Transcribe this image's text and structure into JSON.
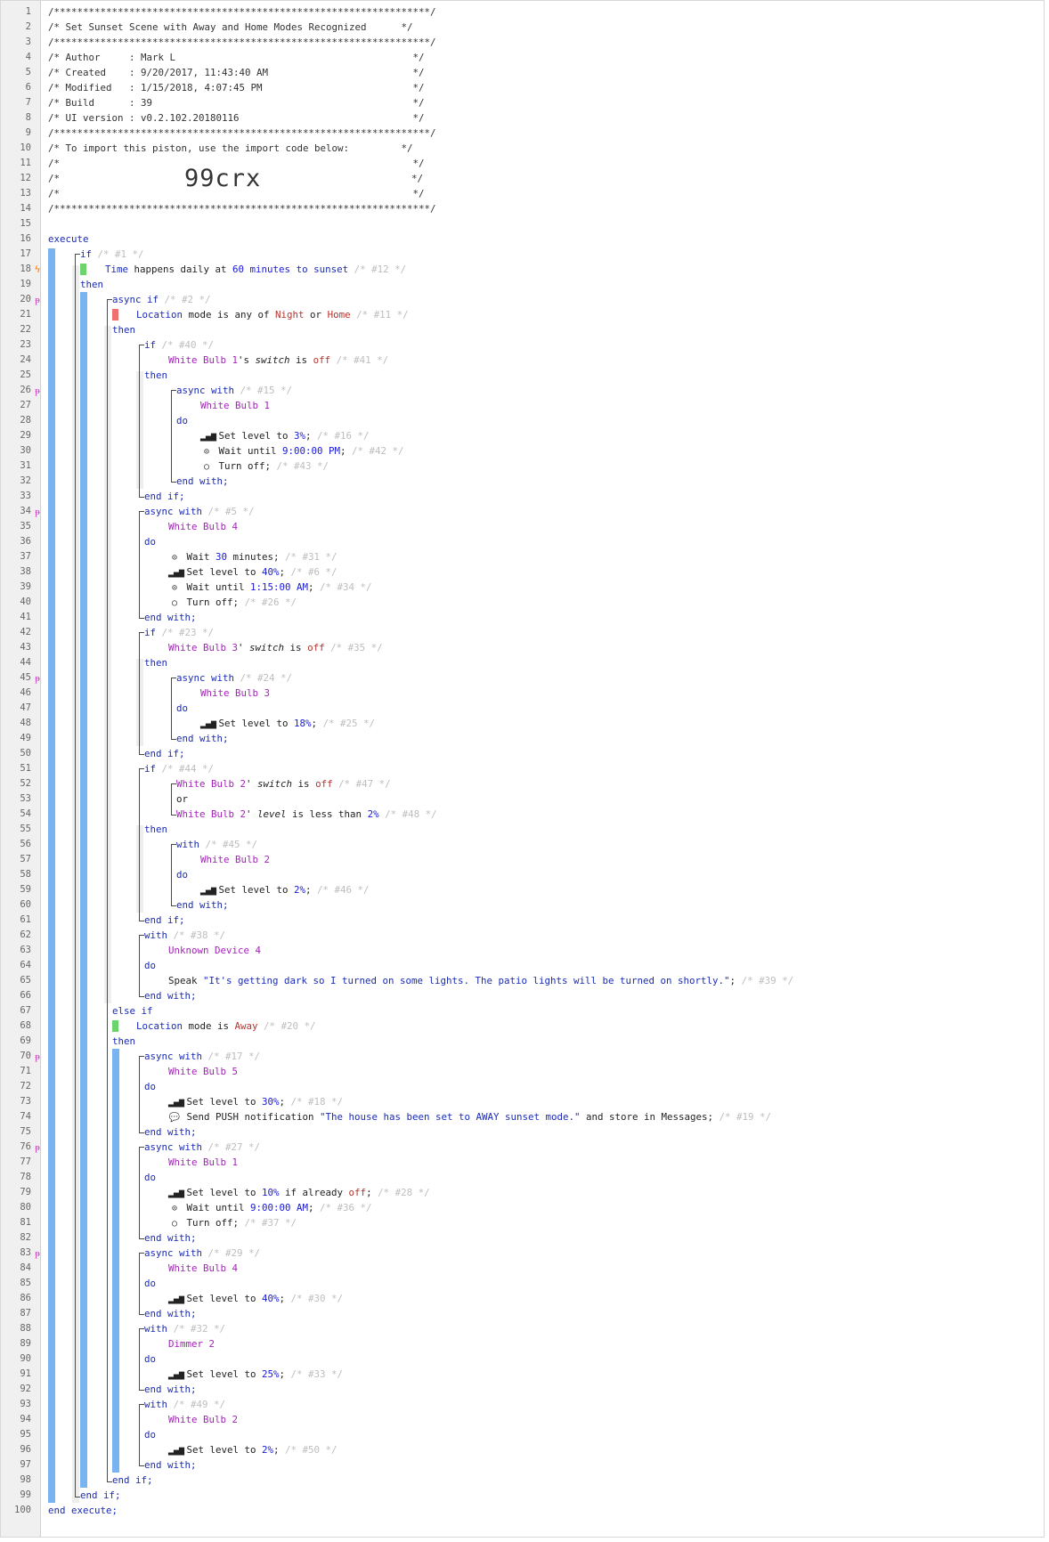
{
  "markers": {
    "async": "ᵽ",
    "trigger": "ϟ",
    "clock": "⊙",
    "signal": "▂▄▆",
    "off": "○",
    "chat": "💬"
  },
  "colors": {
    "bar": "#7ab4f0",
    "green": "#6dd36d",
    "red": "#f07070",
    "keyword": "#1a2bb6",
    "device": "#a324b8",
    "value": "#b5332e",
    "comment": "#bdbdbd"
  },
  "header": {
    "stars": "/*****************************************************************/",
    "title": "/* Set Sunset Scene with Away and Home Modes Recognized      */",
    "author": "/* Author     : Mark L                                         */",
    "created": "/* Created    : 9/20/2017, 11:43:40 AM                         */",
    "modified": "/* Modified   : 1/15/2018, 4:07:45 PM                          */",
    "build": "/* Build      : 39                                             */",
    "ui": "/* UI version : v0.2.102.20180116                              */",
    "import": "/* To import this piston, use the import code below:         */",
    "blank": "/*                                                             */",
    "code_open": "/*",
    "code": "99crx",
    "code_close": "*/"
  },
  "lines": {
    "l16": "execute",
    "l17a": "if",
    "l17b": " /* #1 */",
    "l18a": "Time",
    "l18b": " happens daily at ",
    "l18c": "60",
    "l18d": " minutes ",
    "l18e": "to",
    "l18f": " sunset",
    "l18g": " /* #12 */",
    "l19": "then",
    "l20a": "async if",
    "l20b": " /* #2 */",
    "l21a": "Location",
    "l21b": " mode is any of ",
    "l21c": "Night",
    "l21d": " or ",
    "l21e": "Home",
    "l21f": " /* #11 */",
    "l22": "then",
    "l23a": "if",
    "l23b": " /* #40 */",
    "l24a": "White Bulb 1",
    "l24b": "'s ",
    "l24c": "switch",
    "l24d": " is ",
    "l24e": "off",
    "l24f": " /* #41 */",
    "l25": "then",
    "l26a": "async with",
    "l26b": " /* #15 */",
    "l27": "White Bulb 1",
    "l28": "do",
    "l29a": " Set level to ",
    "l29b": "3%",
    "l29c": ";",
    "l29d": " /* #16 */",
    "l30a": " Wait until ",
    "l30b": "9:00:00 PM",
    "l30c": ";",
    "l30d": " /* #42 */",
    "l31a": " Turn off;",
    "l31b": " /* #43 */",
    "l32": "end with;",
    "l33": "end if;",
    "l34a": "async with",
    "l34b": " /* #5 */",
    "l35": "White Bulb 4",
    "l36": "do",
    "l37a": " Wait ",
    "l37b": "30",
    "l37c": " minutes;",
    "l37d": " /* #31 */",
    "l38a": " Set level to ",
    "l38b": "40%",
    "l38c": ";",
    "l38d": " /* #6 */",
    "l39a": " Wait until ",
    "l39b": "1:15:00 AM",
    "l39c": ";",
    "l39d": " /* #34 */",
    "l40a": " Turn off;",
    "l40b": " /* #26 */",
    "l41": "end with;",
    "l42a": "if",
    "l42b": " /* #23 */",
    "l43a": "White Bulb 3",
    "l43b": "' ",
    "l43c": "switch",
    "l43d": " is ",
    "l43e": "off",
    "l43f": " /* #35 */",
    "l44": "then",
    "l45a": "async with",
    "l45b": " /* #24 */",
    "l46": "White Bulb 3",
    "l47": "do",
    "l48a": " Set level to ",
    "l48b": "18%",
    "l48c": ";",
    "l48d": " /* #25 */",
    "l49": "end with;",
    "l50": "end if;",
    "l51a": "if",
    "l51b": " /* #44 */",
    "l52a": "White Bulb 2",
    "l52b": "' ",
    "l52c": "switch",
    "l52d": " is ",
    "l52e": "off",
    "l52f": " /* #47 */",
    "l53": "or",
    "l54a": "White Bulb 2",
    "l54b": "' ",
    "l54c": "level",
    "l54d": " is less than ",
    "l54e": "2%",
    "l54f": " /* #48 */",
    "l55": "then",
    "l56a": "with",
    "l56b": " /* #45 */",
    "l57": "White Bulb 2",
    "l58": "do",
    "l59a": " Set level to ",
    "l59b": "2%",
    "l59c": ";",
    "l59d": " /* #46 */",
    "l60": "end with;",
    "l61": "end if;",
    "l62a": "with",
    "l62b": " /* #38 */",
    "l63": "Unknown Device 4",
    "l64": "do",
    "l65a": "Speak ",
    "l65b": "\"It's getting dark so I turned on some lights. The patio lights will be turned on shortly.\"",
    "l65c": ";",
    "l65d": " /* #39 */",
    "l66": "end with;",
    "l67": "else if",
    "l68a": "Location",
    "l68b": " mode is ",
    "l68c": "Away",
    "l68d": " /* #20 */",
    "l69": "then",
    "l70a": "async with",
    "l70b": " /* #17 */",
    "l71": "White Bulb 5",
    "l72": "do",
    "l73a": " Set level to ",
    "l73b": "30%",
    "l73c": ";",
    "l73d": " /* #18 */",
    "l74a": " Send PUSH notification ",
    "l74b": "\"The house has been set to AWAY sunset mode.\"",
    "l74c": " and store in Messages;",
    "l74d": " /* #19 */",
    "l75": "end with;",
    "l76a": "async with",
    "l76b": " /* #27 */",
    "l77": "White Bulb 1",
    "l78": "do",
    "l79a": " Set level to ",
    "l79b": "10%",
    "l79c": " if already ",
    "l79d": "off",
    "l79e": ";",
    "l79f": " /* #28 */",
    "l80a": " Wait until ",
    "l80b": "9:00:00 AM",
    "l80c": ";",
    "l80d": " /* #36 */",
    "l81a": " Turn off;",
    "l81b": " /* #37 */",
    "l82": "end with;",
    "l83a": "async with",
    "l83b": " /* #29 */",
    "l84": "White Bulb 4",
    "l85": "do",
    "l86a": " Set level to ",
    "l86b": "40%",
    "l86c": ";",
    "l86d": " /* #30 */",
    "l87": "end with;",
    "l88a": "with",
    "l88b": " /* #32 */",
    "l89": "Dimmer 2",
    "l90": "do",
    "l91a": " Set level to ",
    "l91b": "25%",
    "l91c": ";",
    "l91d": " /* #33 */",
    "l92": "end with;",
    "l93a": "with",
    "l93b": " /* #49 */",
    "l94": "White Bulb 2",
    "l95": "do",
    "l96a": " Set level to ",
    "l96b": "2%",
    "l96c": ";",
    "l96d": " /* #50 */",
    "l97": "end with;",
    "l98": "end if;",
    "l99": "end if;",
    "l100": "end execute;"
  }
}
